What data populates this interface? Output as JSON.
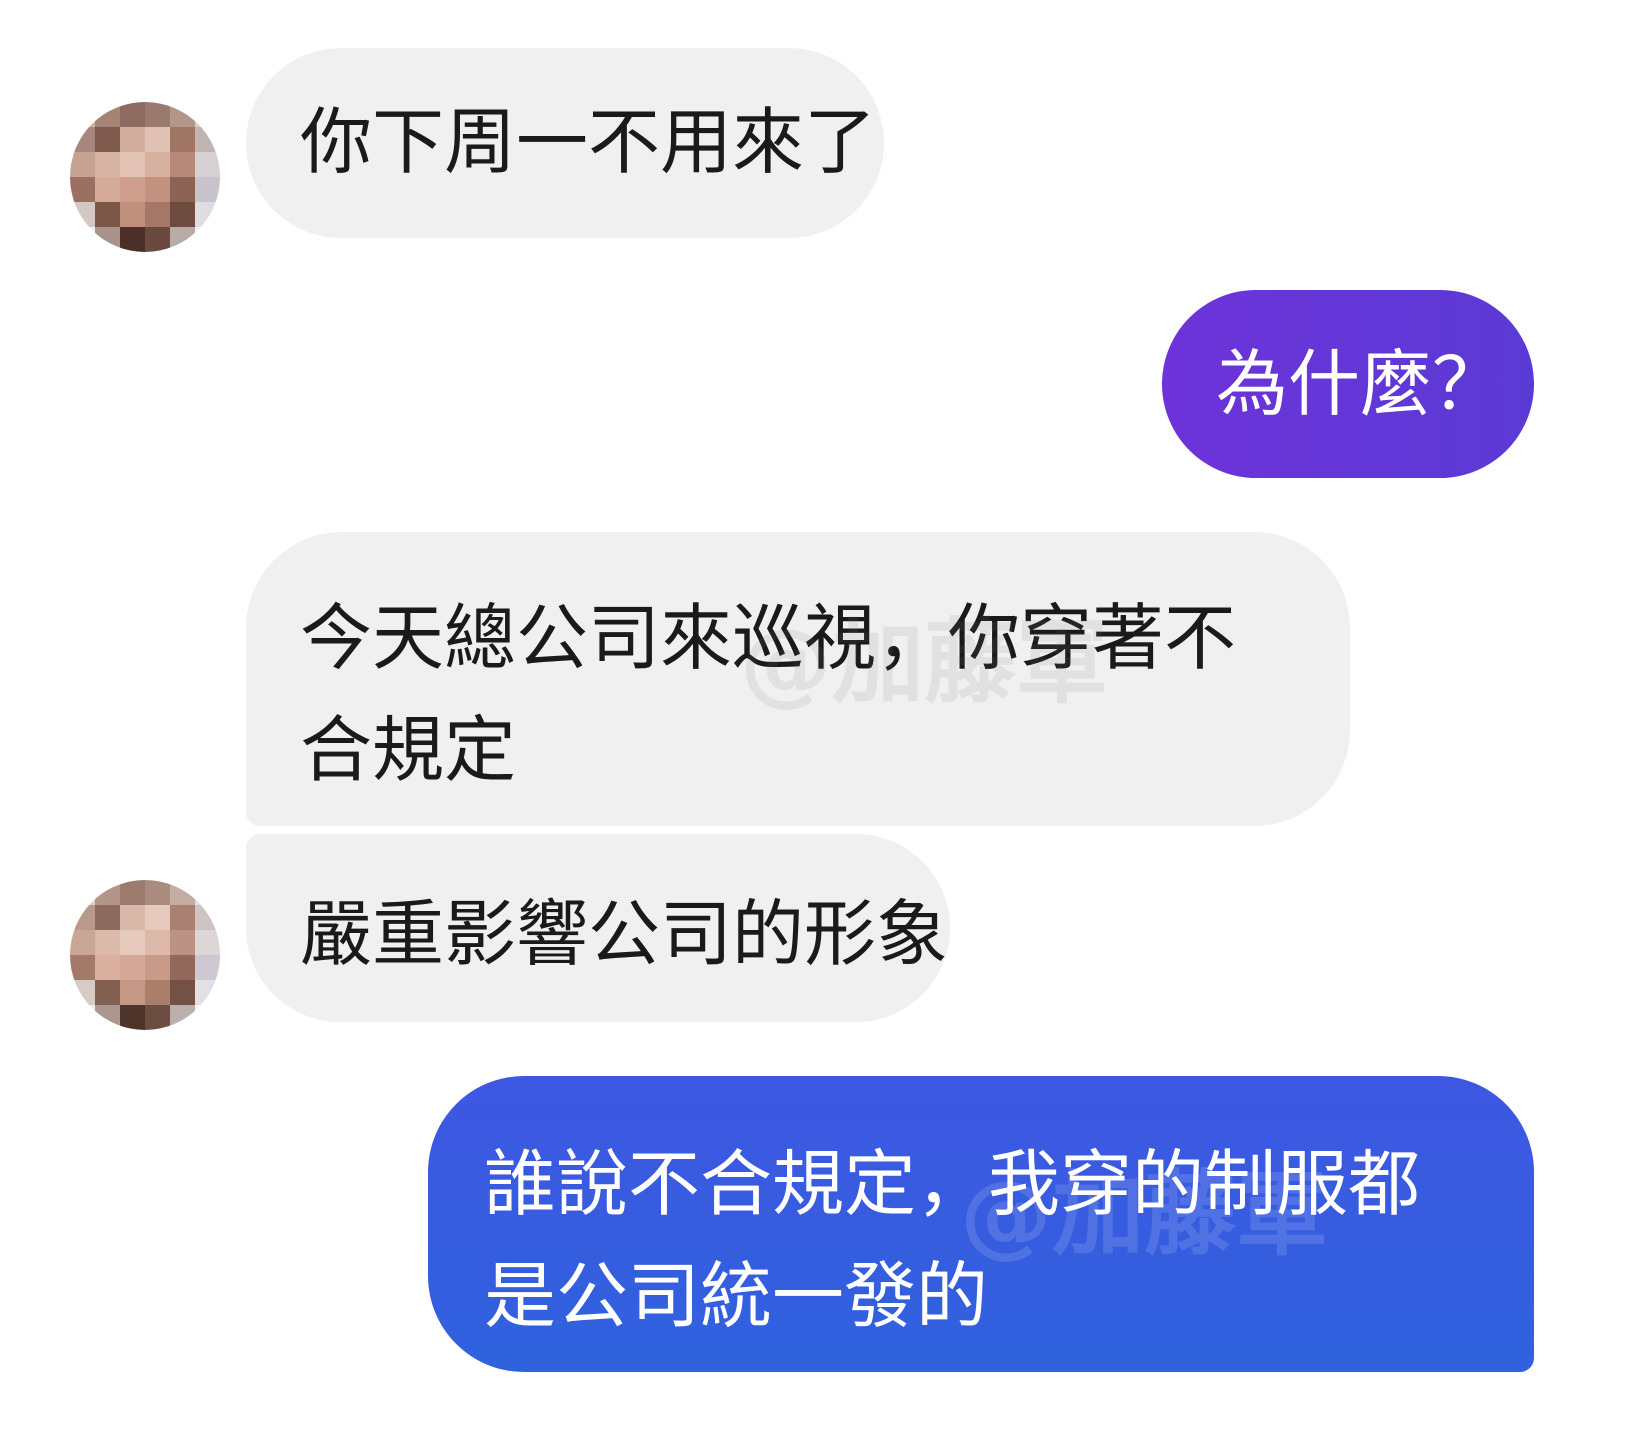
{
  "conversation": {
    "messages": [
      {
        "side": "incoming",
        "text": "你下周一不用來了"
      },
      {
        "side": "outgoing",
        "text": "為什麼？"
      },
      {
        "side": "incoming",
        "text": "今天總公司來巡視，你穿著不合規定"
      },
      {
        "side": "incoming",
        "text": "嚴重影響公司的形象"
      },
      {
        "side": "outgoing",
        "text": "誰說不合規定，我穿的制服都是公司統一發的"
      }
    ]
  },
  "watermark": {
    "text": "@加藤軍"
  },
  "colors": {
    "incoming_bubble": "#f0f0f0",
    "outgoing_purple": "#6a33d3",
    "outgoing_blue": "#3a5ae0",
    "text_dark": "#1a1a1a",
    "text_light": "#ffffff"
  },
  "avatar": {
    "description_icon": "blurred-profile-photo-icon"
  }
}
